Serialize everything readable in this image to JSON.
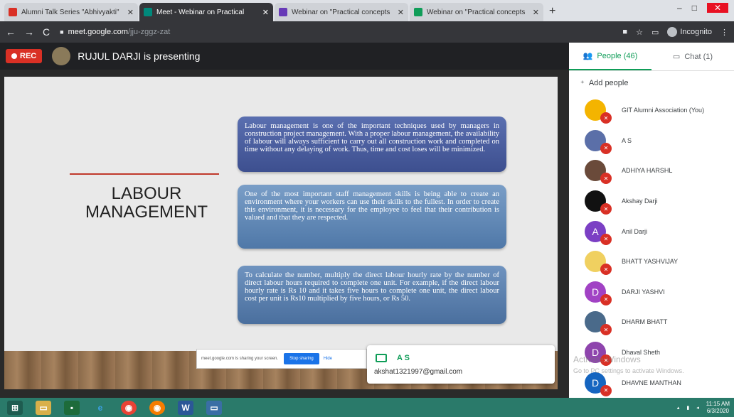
{
  "browser": {
    "tabs": [
      {
        "title": "Alumni Talk Series \"Abhivyakti\"",
        "color": "#d93025",
        "active": false
      },
      {
        "title": "Meet - Webinar on Practical",
        "color": "#00897b",
        "active": true
      },
      {
        "title": "Webinar on \"Practical concepts",
        "color": "#673ab7",
        "active": false
      },
      {
        "title": "Webinar on \"Practical concepts",
        "color": "#0f9d58",
        "active": false
      }
    ],
    "url_host": "meet.google.com",
    "url_path": "/jju-zggz-zat",
    "incognito_label": "Incognito"
  },
  "meet": {
    "rec_label": "REC",
    "presenting_text": "RUJUL DARJI is presenting"
  },
  "slide": {
    "title_line1": "LABOUR",
    "title_line2": "MANAGEMENT",
    "box1": "Labour management is one of the important techniques used by managers in construction project management. With a proper labour management, the availability of labour will always sufficient to carry out all construction work and completed on time without any delaying of work. Thus, time and cost loses will be minimized.",
    "box2": "One of the most important staff management skills is being able to create an environment where your workers can use their skills to the fullest. In order to create this environment, it is necessary for the employee to feel that their contribution is valued and that they are respected.",
    "box3": "To calculate the number, multiply the direct labour hourly rate by the number of direct labour hours required to complete one unit. For example, if the direct labour hourly rate is Rs 10 and it takes five hours to complete one unit, the direct labour cost per unit is Rs10 multiplied by five hours, or Rs 50."
  },
  "sharing": {
    "message": "meet.google.com is sharing your screen.",
    "stop_label": "Stop sharing",
    "hide_label": "Hide"
  },
  "chat_popup": {
    "name": "A S",
    "email": "akshat1321997@gmail.com"
  },
  "panel": {
    "people_tab": "People (46)",
    "chat_tab": "Chat (1)",
    "add_people": "Add people",
    "people": [
      {
        "name": "GIT Alumni Association (You)",
        "initial": "",
        "color": "#f4b400"
      },
      {
        "name": "A S",
        "initial": "",
        "color": "#5b6fa8"
      },
      {
        "name": "ADHIYA HARSHL",
        "initial": "",
        "color": "#6a4a3a"
      },
      {
        "name": "Akshay Darji",
        "initial": "",
        "color": "#111111"
      },
      {
        "name": "Anil Darji",
        "initial": "A",
        "color": "#7b3fc4"
      },
      {
        "name": "BHATT YASHVIJAY",
        "initial": "",
        "color": "#f0d060"
      },
      {
        "name": "DARJI YASHVI",
        "initial": "D",
        "color": "#a142c4"
      },
      {
        "name": "DHARM BHATT",
        "initial": "",
        "color": "#4a6a8a"
      },
      {
        "name": "Dhaval Sheth",
        "initial": "D",
        "color": "#8e44ad"
      },
      {
        "name": "DHAVNE MANTHAN",
        "initial": "D",
        "color": "#1565c0"
      }
    ]
  },
  "watermark": {
    "line1": "Activate Windows",
    "line2": "Go to PC settings to activate Windows."
  },
  "taskbar": {
    "time": "11:15 AM",
    "date": "6/3/2020"
  }
}
